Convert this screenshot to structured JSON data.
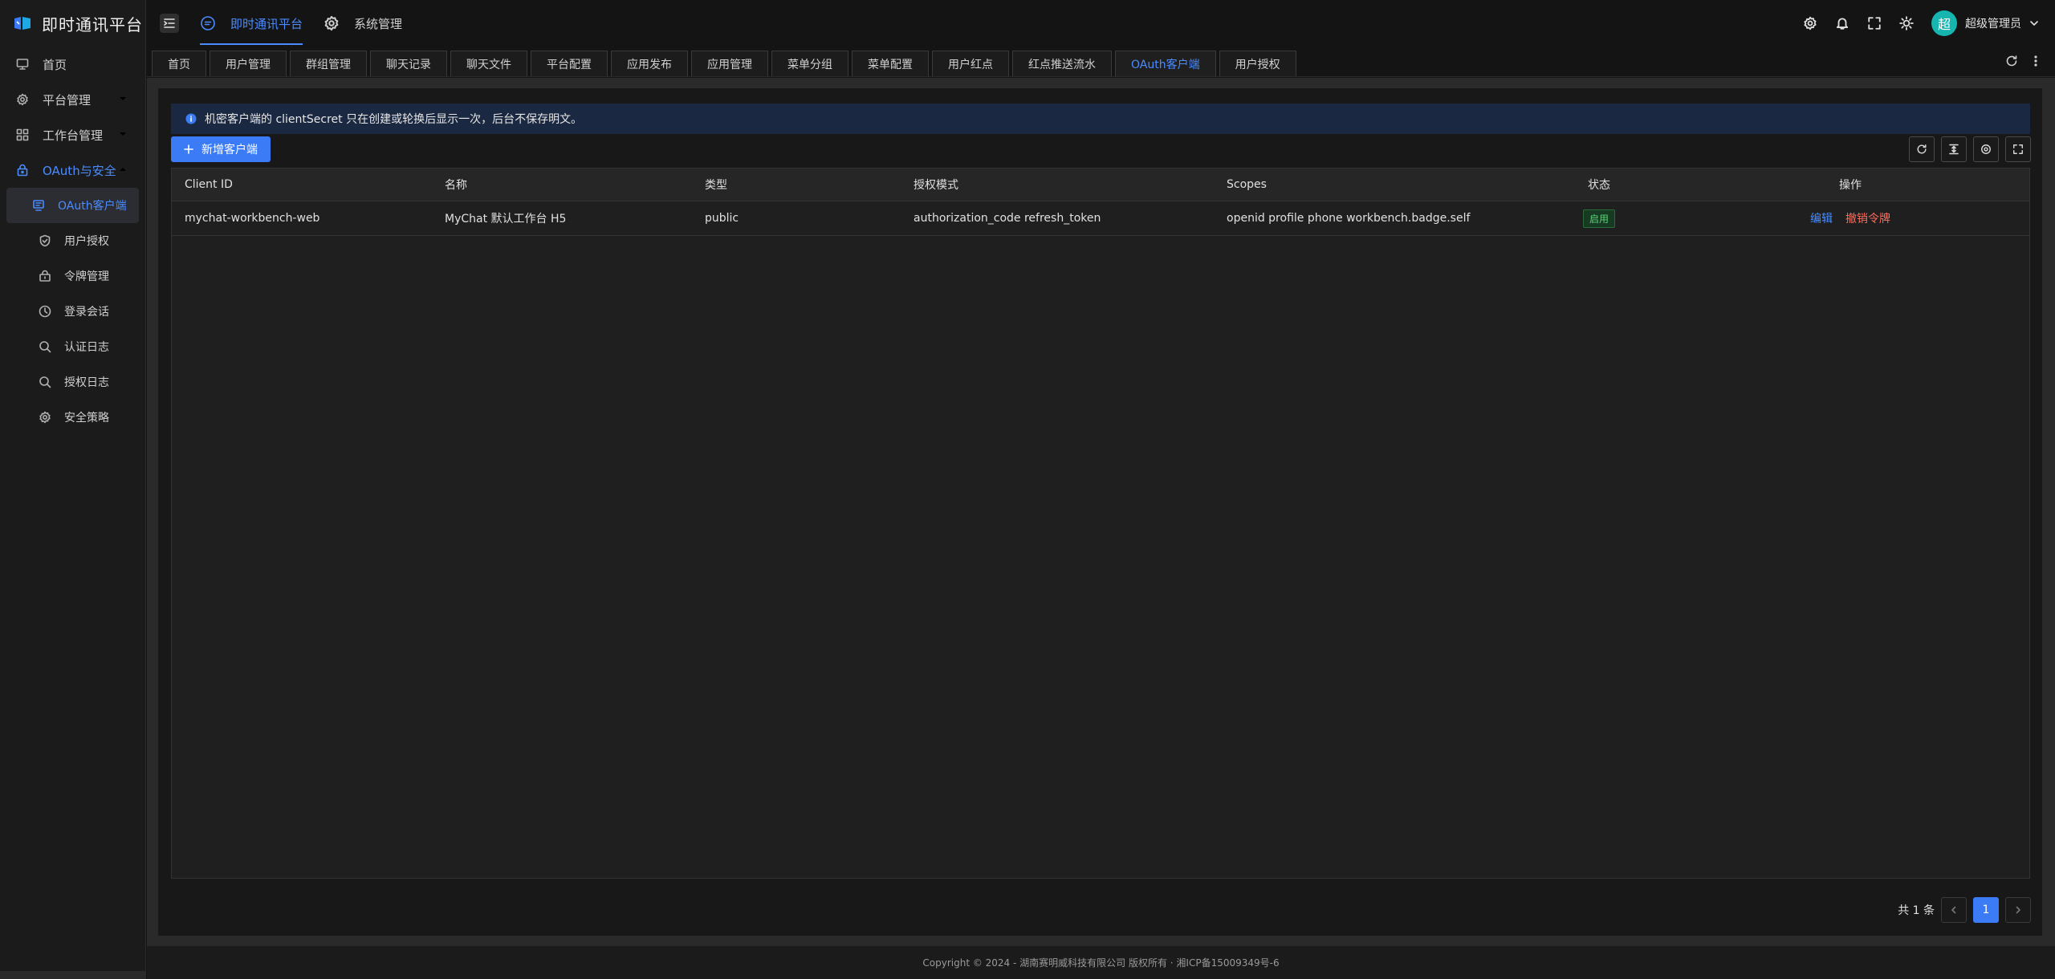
{
  "app": {
    "title": "即时通讯平台"
  },
  "sidebar": {
    "items": [
      {
        "label": "首页",
        "icon": "monitor-icon"
      },
      {
        "label": "平台管理",
        "icon": "gear-icon"
      },
      {
        "label": "工作台管理",
        "icon": "grid-icon"
      },
      {
        "label": "OAuth与安全",
        "icon": "lock-icon"
      }
    ],
    "sub_items": [
      {
        "label": "OAuth客户端",
        "icon": "client-icon"
      },
      {
        "label": "用户授权",
        "icon": "shield-icon"
      },
      {
        "label": "令牌管理",
        "icon": "key-icon"
      },
      {
        "label": "登录会话",
        "icon": "clock-icon"
      },
      {
        "label": "认证日志",
        "icon": "search-icon"
      },
      {
        "label": "授权日志",
        "icon": "search-icon"
      },
      {
        "label": "安全策略",
        "icon": "gear-icon"
      }
    ]
  },
  "header": {
    "tabs": [
      {
        "label": "即时通讯平台",
        "icon": "chat-icon"
      },
      {
        "label": "系统管理",
        "icon": "gear-icon"
      }
    ],
    "user": {
      "avatar_text": "超",
      "name": "超级管理员"
    }
  },
  "tabs": [
    "首页",
    "用户管理",
    "群组管理",
    "聊天记录",
    "聊天文件",
    "平台配置",
    "应用发布",
    "应用管理",
    "菜单分组",
    "菜单配置",
    "用户红点",
    "红点推送流水",
    "OAuth客户端",
    "用户授权"
  ],
  "alert": {
    "text": "机密客户端的 clientSecret 只在创建或轮换后显示一次，后台不保存明文。"
  },
  "toolbar": {
    "add_label": "新增客户端"
  },
  "table": {
    "columns": [
      "Client ID",
      "名称",
      "类型",
      "授权模式",
      "Scopes",
      "状态",
      "操作"
    ],
    "rows": [
      {
        "client_id": "mychat-workbench-web",
        "name": "MyChat 默认工作台 H5",
        "type": "public",
        "grant": "authorization_code refresh_token",
        "scopes": "openid profile phone workbench.badge.self",
        "status": "启用",
        "actions": {
          "edit": "编辑",
          "revoke": "撤销令牌"
        }
      }
    ]
  },
  "pagination": {
    "total_text": "共 1 条",
    "current_page": "1"
  },
  "footer": {
    "text": "Copyright © 2024 - 湖南赛明威科技有限公司 版权所有 · 湘ICP备15009349号-6"
  },
  "colors": {
    "accent": "#3b7cf6",
    "danger": "#ff6b5b",
    "success": "#5fd07a",
    "avatar": "#16b5b0"
  }
}
